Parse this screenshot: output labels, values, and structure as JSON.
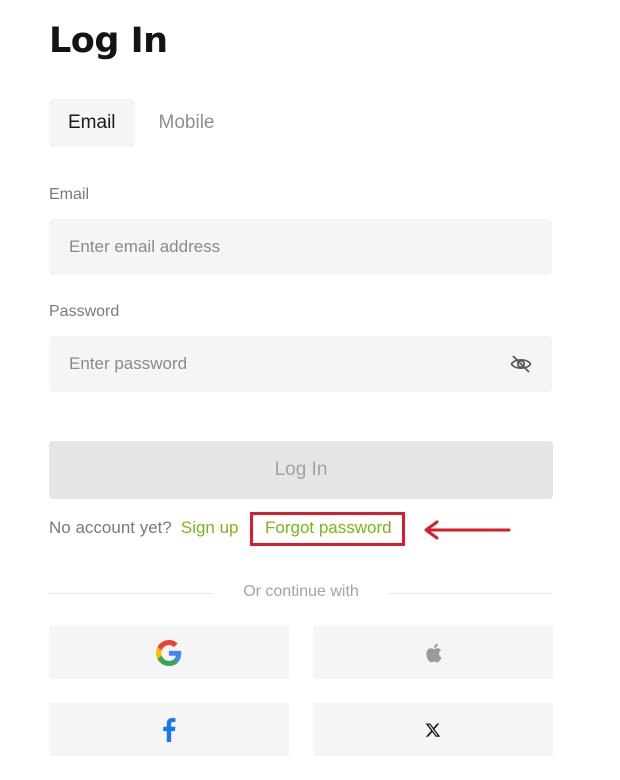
{
  "page": {
    "title": "Log In"
  },
  "tabs": [
    {
      "label": "Email",
      "active": true
    },
    {
      "label": "Mobile",
      "active": false
    }
  ],
  "form": {
    "email_label": "Email",
    "email_placeholder": "Enter email address",
    "email_value": "",
    "password_label": "Password",
    "password_placeholder": "Enter password",
    "password_value": "",
    "password_toggle_icon": "eye-off-icon",
    "submit_label": "Log In"
  },
  "links": {
    "no_account_text": "No account yet?",
    "signup_label": "Sign up",
    "forgot_label": "Forgot password"
  },
  "social": {
    "divider_text": "Or continue with",
    "providers": [
      {
        "name": "google",
        "icon": "google-icon"
      },
      {
        "name": "apple",
        "icon": "apple-icon"
      },
      {
        "name": "facebook",
        "icon": "facebook-icon"
      },
      {
        "name": "x",
        "icon": "x-icon"
      }
    ]
  },
  "colors": {
    "accent_green": "#7cb518",
    "highlight_red": "#d81e2a",
    "field_background": "#f5f5f5",
    "disabled_button": "#e5e5e5"
  }
}
